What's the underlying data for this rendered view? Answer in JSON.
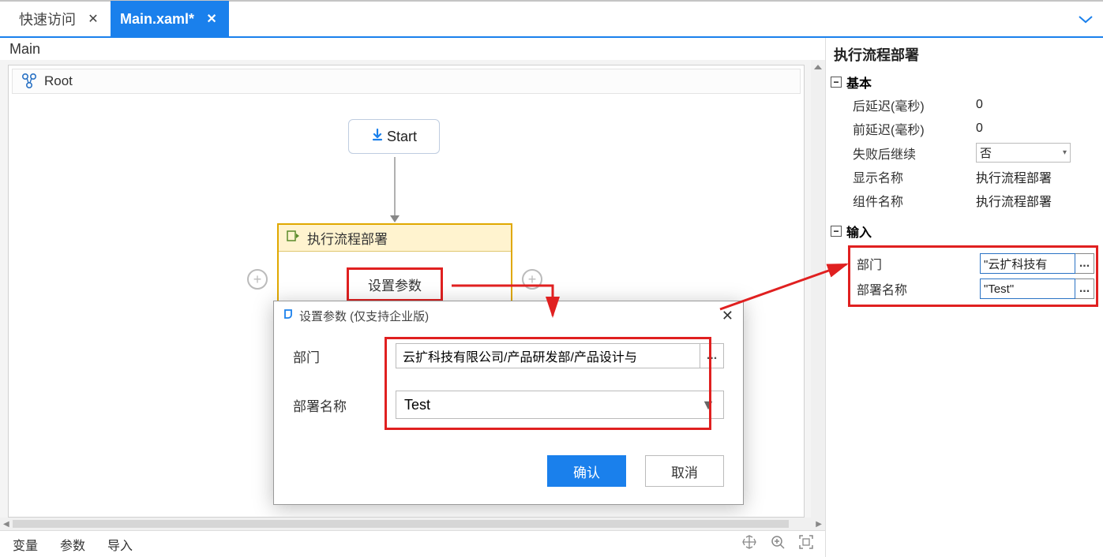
{
  "tabs": {
    "tab1": {
      "label": "快速访问"
    },
    "tab2": {
      "label": "Main.xaml*"
    }
  },
  "breadcrumb": "Main",
  "root_label": "Root",
  "start_label": "Start",
  "activity": {
    "title": "执行流程部署",
    "set_params_btn": "设置参数"
  },
  "dialog": {
    "title": "设置参数 (仅支持企业版)",
    "dept_label": "部门",
    "dept_value": "云扩科技有限公司/产品研发部/产品设计与",
    "name_label": "部署名称",
    "name_value": "Test",
    "confirm": "确认",
    "cancel": "取消"
  },
  "bottom_tabs": {
    "vars": "变量",
    "params": "参数",
    "import": "导入"
  },
  "props": {
    "panel_title": "执行流程部署",
    "section_basic": "基本",
    "section_input": "输入",
    "rows": {
      "after_delay_label": "后延迟(毫秒)",
      "after_delay_value": "0",
      "before_delay_label": "前延迟(毫秒)",
      "before_delay_value": "0",
      "continue_on_fail_label": "失败后继续",
      "continue_on_fail_value": "否",
      "display_name_label": "显示名称",
      "display_name_value": "执行流程部署",
      "component_name_label": "组件名称",
      "component_name_value": "执行流程部署",
      "dept_label": "部门",
      "dept_value": "\"云扩科技有",
      "deploy_name_label": "部署名称",
      "deploy_name_value": "\"Test\""
    }
  }
}
